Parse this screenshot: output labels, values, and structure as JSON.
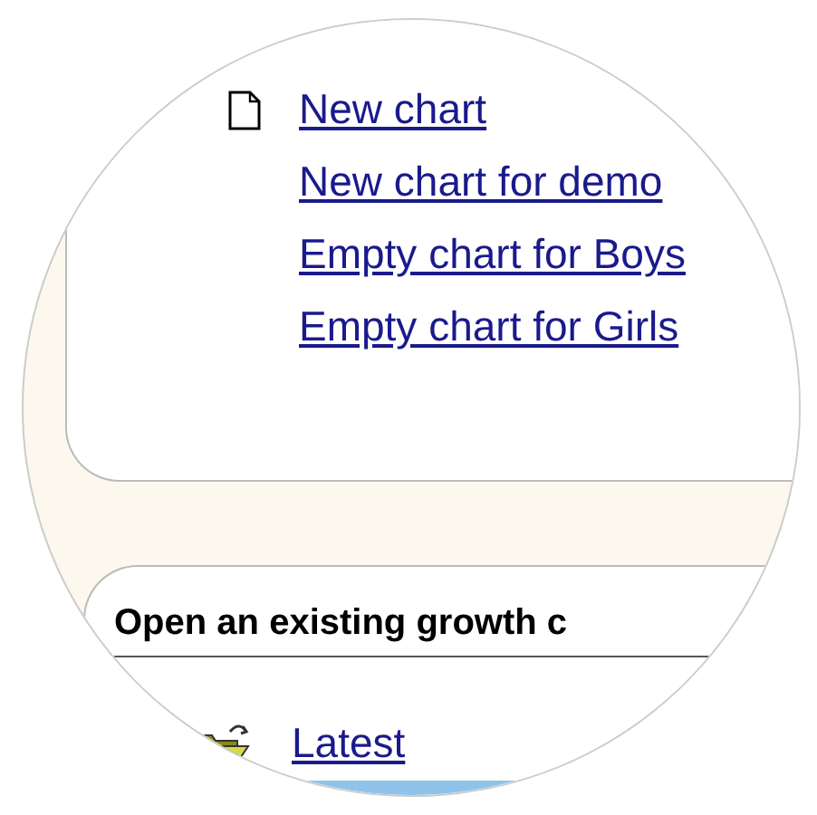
{
  "new_chart_section": {
    "links": [
      {
        "label": "New chart",
        "kind": "new"
      },
      {
        "label": "New chart for demo",
        "kind": "plain"
      },
      {
        "label": "Empty chart for Boys",
        "kind": "plain"
      },
      {
        "label": "Empty chart for Girls",
        "kind": "plain"
      }
    ]
  },
  "open_section": {
    "heading": "Open an existing growth c",
    "links": [
      {
        "label": "Latest",
        "kind": "open"
      }
    ]
  }
}
